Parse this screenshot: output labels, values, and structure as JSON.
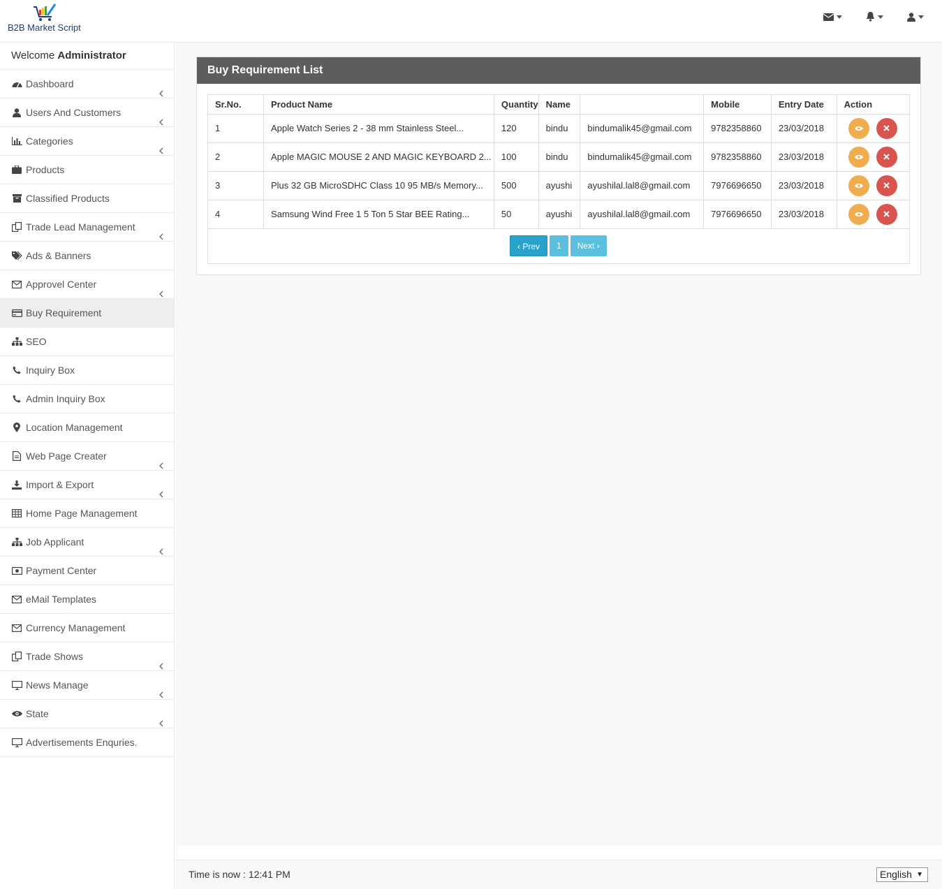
{
  "brand": {
    "name": "B2B Market Script"
  },
  "header_icons": [
    "envelope-icon",
    "bell-icon",
    "user-icon"
  ],
  "welcome": {
    "prefix": "Welcome",
    "user": "Administrator"
  },
  "sidebar": {
    "items": [
      {
        "label": "Dashboard",
        "icon": "dashboard-icon",
        "chevron": true
      },
      {
        "label": "Users And Customers",
        "icon": "user-icon",
        "chevron": true
      },
      {
        "label": "Categories",
        "icon": "bar-chart-icon",
        "chevron": true
      },
      {
        "label": "Products",
        "icon": "briefcase-icon",
        "chevron": false
      },
      {
        "label": "Classified Products",
        "icon": "archive-icon",
        "chevron": false
      },
      {
        "label": "Trade Lead Management",
        "icon": "copy-icon",
        "chevron": true
      },
      {
        "label": "Ads & Banners",
        "icon": "tags-icon",
        "chevron": false
      },
      {
        "label": "Approvel Center",
        "icon": "envelope-icon",
        "chevron": true
      },
      {
        "label": "Buy Requirement",
        "icon": "credit-card-icon",
        "chevron": false,
        "active": true
      },
      {
        "label": "SEO",
        "icon": "sitemap-icon",
        "chevron": false
      },
      {
        "label": "Inquiry Box",
        "icon": "phone-icon",
        "chevron": false
      },
      {
        "label": "Admin Inquiry Box",
        "icon": "phone-icon",
        "chevron": false
      },
      {
        "label": "Location Management",
        "icon": "map-marker-icon",
        "chevron": false
      },
      {
        "label": "Web Page Creater",
        "icon": "file-icon",
        "chevron": true
      },
      {
        "label": "Import & Export",
        "icon": "download-icon",
        "chevron": true
      },
      {
        "label": "Home Page Management",
        "icon": "table-icon",
        "chevron": false
      },
      {
        "label": "Job Applicant",
        "icon": "sitemap-icon",
        "chevron": true
      },
      {
        "label": "Payment Center",
        "icon": "money-icon",
        "chevron": false
      },
      {
        "label": "eMail Templates",
        "icon": "envelope-icon",
        "chevron": false
      },
      {
        "label": "Currency Management",
        "icon": "envelope-icon",
        "chevron": false
      },
      {
        "label": "Trade Shows",
        "icon": "copy-icon",
        "chevron": true
      },
      {
        "label": "News Manage",
        "icon": "desktop-icon",
        "chevron": true
      },
      {
        "label": "State",
        "icon": "eye-icon",
        "chevron": true
      },
      {
        "label": "Advertisements Enquries.",
        "icon": "desktop-icon",
        "chevron": false
      }
    ]
  },
  "panel": {
    "title": "Buy Requirement List",
    "columns": [
      "Sr.No.",
      "Product Name",
      "Quantity",
      "Name",
      "",
      "Mobile",
      "Entry Date",
      "Action"
    ],
    "rows": [
      [
        "1",
        "Apple Watch Series 2 - 38 mm Stainless Steel...",
        "120",
        "bindu",
        "bindumalik45@gmail.com",
        "9782358860",
        "23/03/2018"
      ],
      [
        "2",
        "Apple MAGIC MOUSE 2 AND MAGIC KEYBOARD 2...",
        "100",
        "bindu",
        "bindumalik45@gmail.com",
        "9782358860",
        "23/03/2018"
      ],
      [
        "3",
        "Plus 32 GB MicroSDHC Class 10 95 MB/s Memory...",
        "500",
        "ayushi",
        "ayushilal.lal8@gmail.com",
        "7976696650",
        "23/03/2018"
      ],
      [
        "4",
        "Samsung Wind Free 1 5 Ton 5 Star BEE Rating...",
        "50",
        "ayushi",
        "ayushilal.lal8@gmail.com",
        "7976696650",
        "23/03/2018"
      ]
    ],
    "pagination": {
      "prev": "‹ Prev",
      "page": "1",
      "next": "Next ›"
    }
  },
  "footer": {
    "time": "Time is now : 12:41 PM",
    "language": "English"
  },
  "colors": {
    "panel_heading": "#5d5d5d",
    "view_button": "#f0ad4e",
    "delete_button": "#d9534f",
    "pager": "#5bc0de"
  }
}
